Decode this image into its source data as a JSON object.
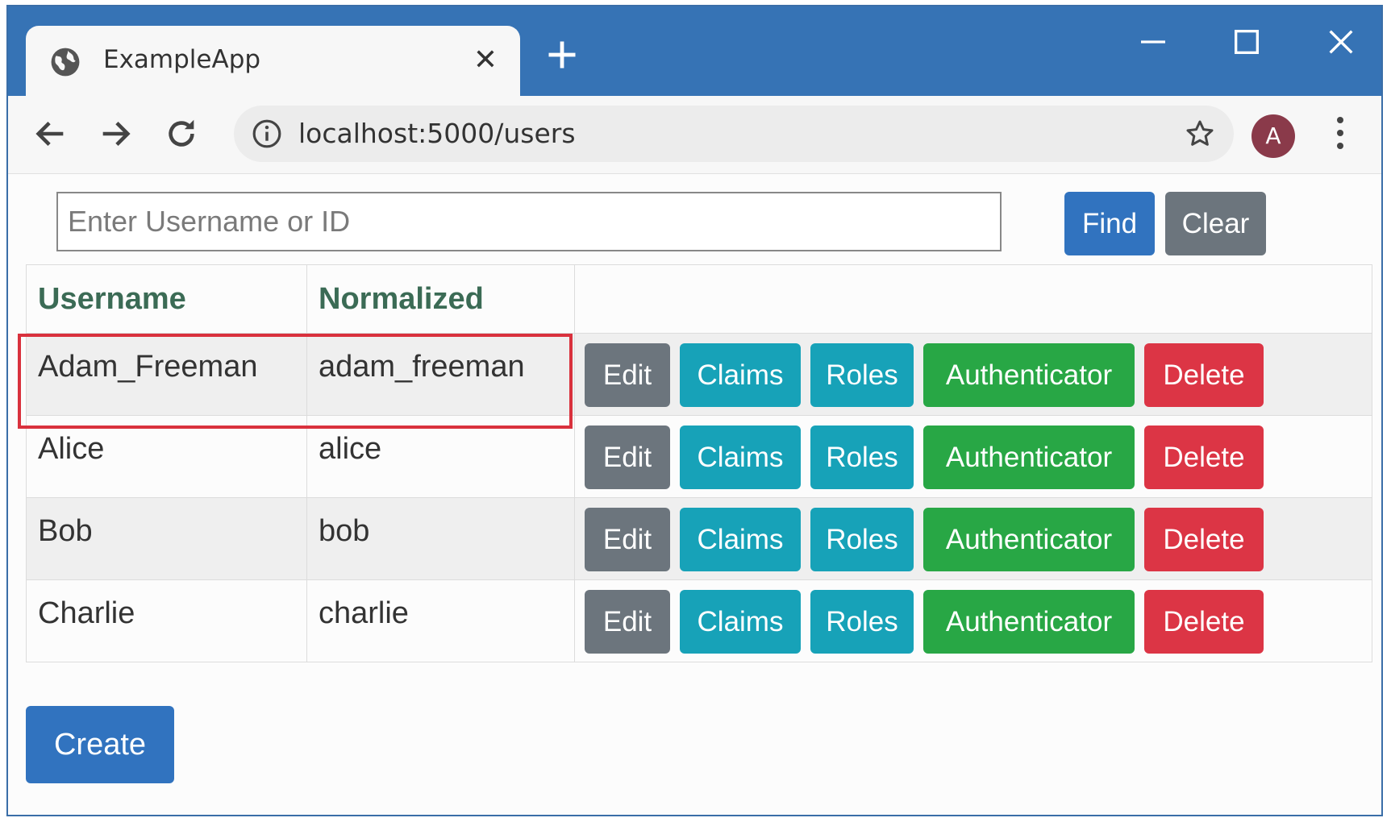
{
  "browser": {
    "tab_title": "ExampleApp",
    "url": "localhost:5000/users",
    "avatar_letter": "A"
  },
  "search": {
    "placeholder": "Enter Username or ID",
    "value": "",
    "find_label": "Find",
    "clear_label": "Clear"
  },
  "table": {
    "headers": [
      "Username",
      "Normalized",
      ""
    ],
    "action_labels": {
      "edit": "Edit",
      "claims": "Claims",
      "roles": "Roles",
      "authenticator": "Authenticator",
      "delete": "Delete"
    },
    "rows": [
      {
        "username": "Adam_Freeman",
        "normalized": "adam_freeman"
      },
      {
        "username": "Alice",
        "normalized": "alice"
      },
      {
        "username": "Bob",
        "normalized": "bob"
      },
      {
        "username": "Charlie",
        "normalized": "charlie"
      }
    ]
  },
  "create_label": "Create",
  "colors": {
    "titlebar": "#3673b5",
    "primary": "#3173bf",
    "secondary": "#6c757d",
    "info": "#17a2b8",
    "success": "#28a745",
    "danger": "#dc3545",
    "highlight": "#d9313d"
  }
}
